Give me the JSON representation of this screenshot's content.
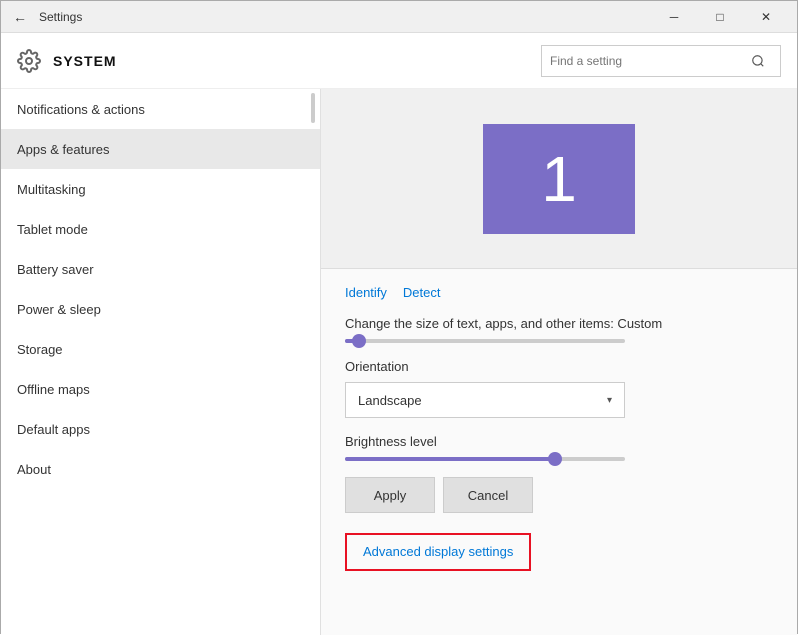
{
  "titleBar": {
    "title": "Settings",
    "backLabel": "←",
    "minLabel": "─",
    "maxLabel": "□",
    "closeLabel": "✕"
  },
  "header": {
    "title": "SYSTEM",
    "searchPlaceholder": "Find a setting",
    "searchIcon": "🔍"
  },
  "sidebar": {
    "items": [
      {
        "label": "Notifications & actions",
        "active": false
      },
      {
        "label": "Apps & features",
        "active": true
      },
      {
        "label": "Multitasking",
        "active": false
      },
      {
        "label": "Tablet mode",
        "active": false
      },
      {
        "label": "Battery saver",
        "active": false
      },
      {
        "label": "Power & sleep",
        "active": false
      },
      {
        "label": "Storage",
        "active": false
      },
      {
        "label": "Offline maps",
        "active": false
      },
      {
        "label": "Default apps",
        "active": false
      },
      {
        "label": "About",
        "active": false
      }
    ]
  },
  "content": {
    "monitorNumber": "1",
    "links": [
      {
        "label": "Identify"
      },
      {
        "label": "Detect"
      }
    ],
    "sizeLabel": "Change the size of text, apps, and other items: Custom",
    "orientationLabel": "Orientation",
    "orientationValue": "Landscape",
    "brightnessLabel": "Brightness level",
    "applyLabel": "Apply",
    "cancelLabel": "Cancel",
    "advancedLabel": "Advanced display settings"
  },
  "colors": {
    "accent": "#7b6ec6",
    "link": "#0078d7",
    "danger": "#e81123"
  }
}
